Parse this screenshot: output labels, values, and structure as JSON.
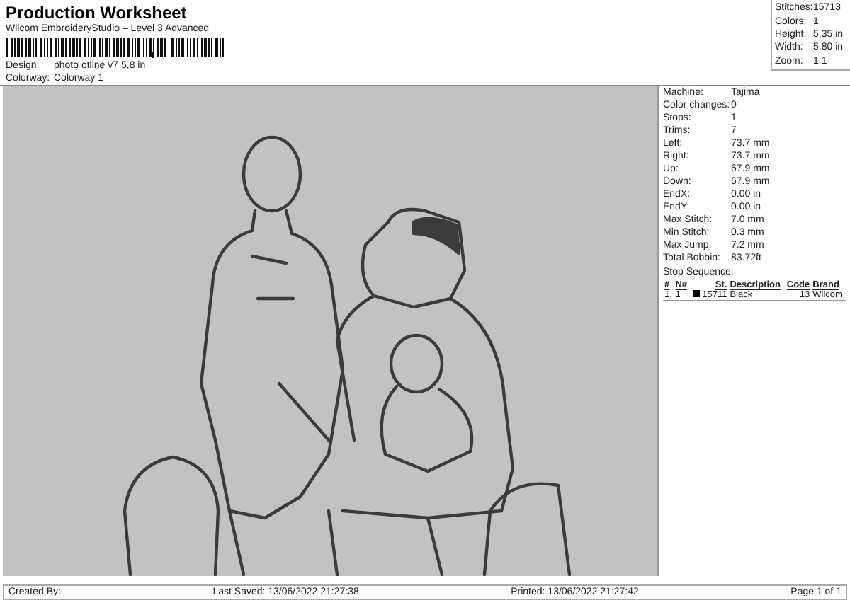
{
  "title": "Production Worksheet",
  "subtitle": "Wilcom EmbroideryStudio – Level 3 Advanced",
  "design": {
    "label": "Design:",
    "value": "photo otline v7 5,8 in"
  },
  "colorway": {
    "label": "Colorway:",
    "value": "Colorway 1"
  },
  "summary": [
    {
      "label": "Stitches:",
      "value": "15713"
    },
    {
      "label": "Colors:",
      "value": "1"
    },
    {
      "label": "Height:",
      "value": "5.35 in"
    },
    {
      "label": "Width:",
      "value": "5.80 in"
    },
    {
      "label": "Zoom:",
      "value": "1:1"
    }
  ],
  "machine_info": [
    {
      "label": "Machine:",
      "value": "Tajima"
    },
    {
      "label": "Color changes:",
      "value": "0"
    },
    {
      "label": "Stops:",
      "value": "1"
    },
    {
      "label": "Trims:",
      "value": "7"
    },
    {
      "label": "Left:",
      "value": "73.7 mm"
    },
    {
      "label": "Right:",
      "value": "73.7 mm"
    },
    {
      "label": "Up:",
      "value": "67.9 mm"
    },
    {
      "label": "Down:",
      "value": "67.9 mm"
    },
    {
      "label": "EndX:",
      "value": "0.00 in"
    },
    {
      "label": "EndY:",
      "value": "0.00 in"
    },
    {
      "label": "Max Stitch:",
      "value": "7.0 mm"
    },
    {
      "label": "Min Stitch:",
      "value": "0.3 mm"
    },
    {
      "label": "Max Jump:",
      "value": "7.2 mm"
    },
    {
      "label": "Total Bobbin:",
      "value": "83.72ft"
    }
  ],
  "stop_sequence": {
    "title": "Stop Sequence:",
    "columns": [
      "#",
      "N#",
      "St.",
      "Description",
      "Code",
      "Brand"
    ],
    "rows": [
      {
        "cells": [
          "1.",
          "1",
          "15711",
          "Black",
          "13",
          "Wilcom"
        ],
        "color": "#000000"
      }
    ]
  },
  "footer": {
    "created_by": "Created By:",
    "last_saved": "Last Saved: 13/06/2022 21:27:38",
    "printed": "Printed: 13/06/2022 21:27:42",
    "page": "Page 1 of 1"
  }
}
